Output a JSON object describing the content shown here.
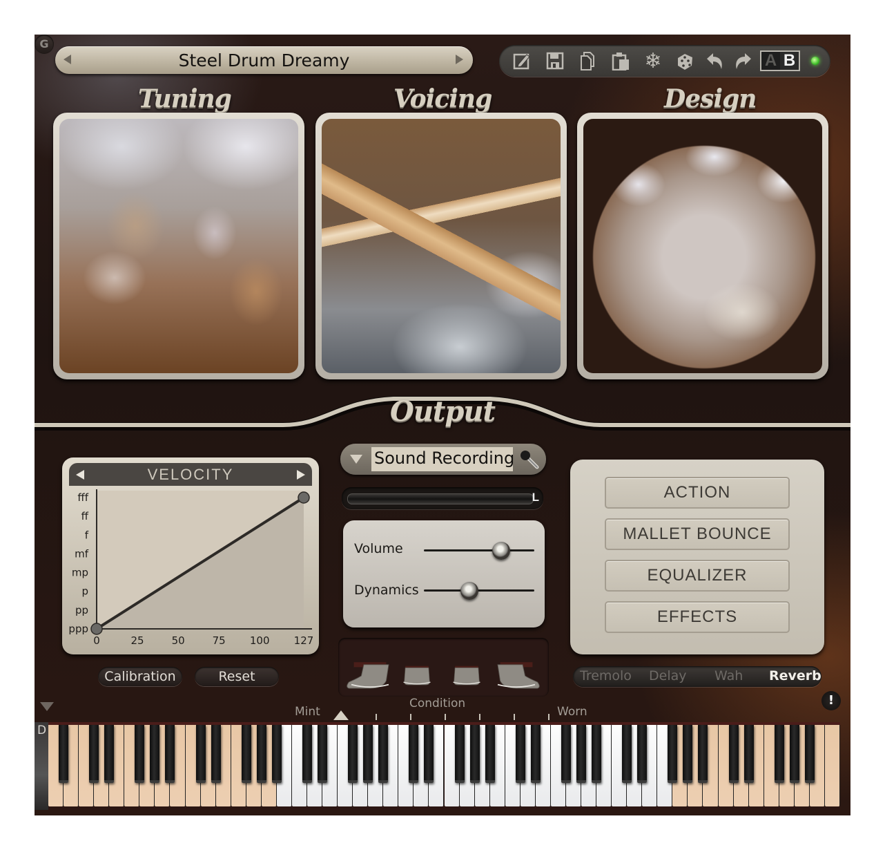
{
  "preset": {
    "name": "Steel Drum Dreamy",
    "prev_icon": "triangle-left-icon",
    "next_icon": "triangle-right-icon"
  },
  "toolbar": {
    "icons": [
      "edit-icon",
      "save-icon",
      "copy-icon",
      "paste-icon",
      "freeze-snowflake-icon",
      "randomize-dice-icon",
      "undo-icon",
      "redo-icon"
    ],
    "ab_a": "A",
    "ab_b": "B",
    "active_ab": "B",
    "led_color": "#4fd23a"
  },
  "sections": {
    "tuning": "Tuning",
    "voicing": "Voicing",
    "design": "Design",
    "output": "Output"
  },
  "velocity": {
    "title": "VELOCITY",
    "chart_data": {
      "type": "line",
      "title": "VELOCITY",
      "xlabel": "",
      "ylabel": "",
      "x_ticks": [
        "0",
        "25",
        "50",
        "75",
        "100",
        "127"
      ],
      "x_tick_values": [
        0,
        25,
        50,
        75,
        100,
        127
      ],
      "y_ticks": [
        "ppp",
        "pp",
        "p",
        "mp",
        "mf",
        "f",
        "ff",
        "fff"
      ],
      "xlim": [
        0,
        127
      ],
      "ylim": [
        0,
        7
      ],
      "series": [
        {
          "name": "velocity curve",
          "points": [
            [
              0,
              0
            ],
            [
              127,
              7
            ]
          ]
        }
      ]
    },
    "calibration_label": "Calibration",
    "reset_label": "Reset",
    "g_label": "G"
  },
  "output": {
    "mode": "Sound Recording",
    "meter_channel": "L",
    "volume_label": "Volume",
    "volume_value": 0.7,
    "dynamics_label": "Dynamics",
    "dynamics_value": 0.41,
    "pedals": 4
  },
  "fx": {
    "buttons": [
      "ACTION",
      "MALLET BOUNCE",
      "EQUALIZER",
      "EFFECTS"
    ],
    "toggles": [
      {
        "label": "Tremolo",
        "active": false
      },
      {
        "label": "Delay",
        "active": false
      },
      {
        "label": "Wah",
        "active": false
      },
      {
        "label": "Reverb",
        "active": true
      }
    ]
  },
  "condition": {
    "title": "Condition",
    "min_label": "Mint",
    "max_label": "Worn",
    "value": 0,
    "steps": 7
  },
  "keyboard": {
    "indicator": "D",
    "first_note": "A0",
    "white_keys": 52,
    "highlight_range": [
      "A0",
      "B7"
    ]
  },
  "warning_icon": "!",
  "colors": {
    "accent_text": "#d6cfc0",
    "panel_bg": "#d7d3cc",
    "keyboard_tan": "#e8c7a5"
  }
}
